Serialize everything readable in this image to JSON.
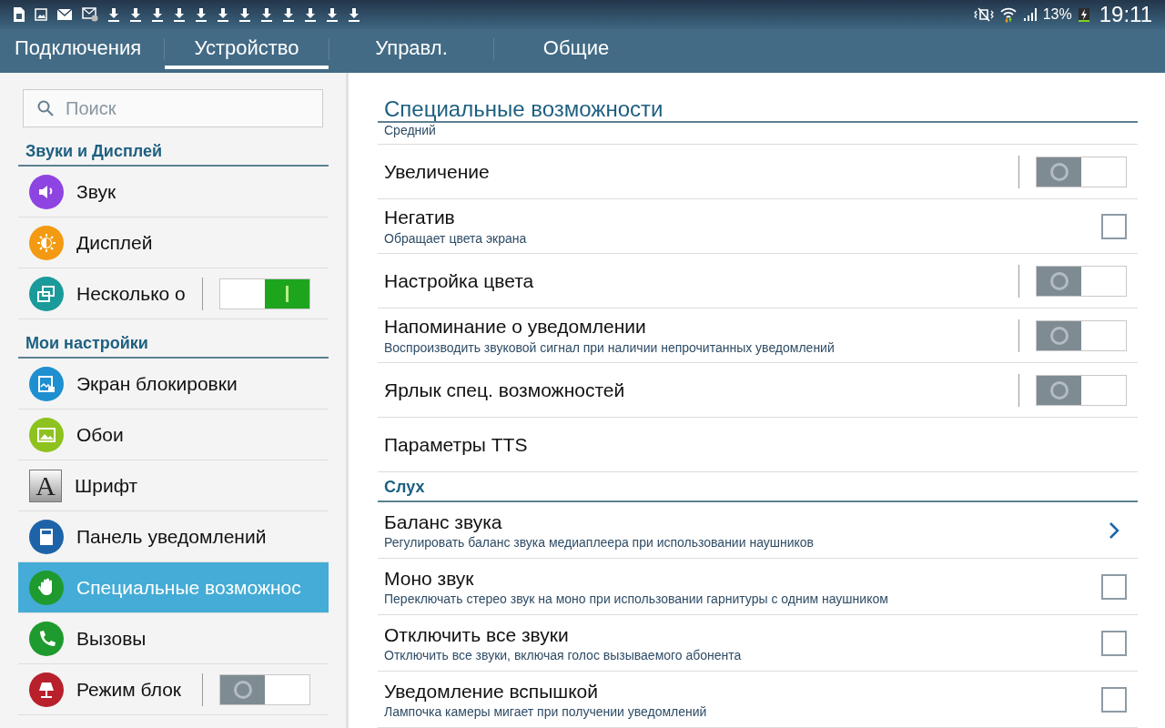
{
  "status_bar": {
    "battery_text": "13%",
    "time": "19:11"
  },
  "tabs": [
    {
      "label": "Подключения",
      "selected": false
    },
    {
      "label": "Устройство",
      "selected": true
    },
    {
      "label": "Управл.",
      "selected": false
    },
    {
      "label": "Общие",
      "selected": false
    }
  ],
  "sidebar": {
    "search": {
      "placeholder": "Поиск"
    },
    "sections": [
      {
        "title": "Звуки и Дисплей",
        "items": [
          {
            "label": "Звук",
            "kind": "circle",
            "color": "#8e44e0",
            "selected": false
          },
          {
            "label": "Дисплей",
            "kind": "circle",
            "color": "#f39a12",
            "selected": false
          },
          {
            "label": "Несколько о",
            "kind": "circle",
            "color": "#1a9a9a",
            "selected": false,
            "switch": {
              "on": true
            }
          }
        ]
      },
      {
        "title": "Мои настройки",
        "items": [
          {
            "label": "Экран блокировки",
            "kind": "circle",
            "color": "#1e8fd0",
            "selected": false
          },
          {
            "label": "Обои",
            "kind": "circle",
            "color": "#8dc21f",
            "selected": false
          },
          {
            "label": "Шрифт",
            "kind": "tile",
            "glyph": "A",
            "selected": false
          },
          {
            "label": "Панель уведомлений",
            "kind": "circle",
            "color": "#1e63a8",
            "selected": false
          },
          {
            "label": "Специальные возможнос",
            "kind": "circle",
            "color": "#1f9a2e",
            "selected": true
          },
          {
            "label": "Вызовы",
            "kind": "circle",
            "color": "#1f9a2e",
            "selected": false
          },
          {
            "label": "Режим блок",
            "kind": "circle",
            "color": "#b8202c",
            "selected": false,
            "switch": {
              "on": false
            }
          }
        ]
      }
    ]
  },
  "content": {
    "title": "Специальные возможности",
    "groups": [
      {
        "rows": [
          {
            "kind": "plain",
            "subtitle": "Средний"
          },
          {
            "kind": "toggle",
            "title": "Увеличение",
            "on": false
          },
          {
            "kind": "checkbox",
            "title": "Негатив",
            "subtitle": "Обращает цвета экрана",
            "checked": false
          },
          {
            "kind": "toggle",
            "title": "Настройка цвета",
            "on": false
          },
          {
            "kind": "toggle",
            "title": "Напоминание о уведомлении",
            "subtitle": "Воспроизводить звуковой сигнал при наличии непрочитанных уведомлений",
            "on": false
          },
          {
            "kind": "toggle",
            "title": "Ярлык спец. возможностей",
            "on": false
          },
          {
            "kind": "plain",
            "title": "Параметры TTS"
          }
        ]
      },
      {
        "header": "Слух",
        "rows": [
          {
            "kind": "link",
            "title": "Баланс звука",
            "subtitle": "Регулировать баланс звука медиаплеера при использовании наушников"
          },
          {
            "kind": "checkbox",
            "title": "Моно звук",
            "subtitle": "Переключать стерео звук на моно при использовании гарнитуры с одним наушником",
            "checked": false
          },
          {
            "kind": "checkbox",
            "title": "Отключить все звуки",
            "subtitle": "Отключить все звуки, включая голос вызываемого абонента",
            "checked": false
          },
          {
            "kind": "checkbox",
            "title": "Уведомление вспышкой",
            "subtitle": "Лампочка камеры мигает при получении уведомлений",
            "checked": false
          }
        ]
      }
    ]
  }
}
